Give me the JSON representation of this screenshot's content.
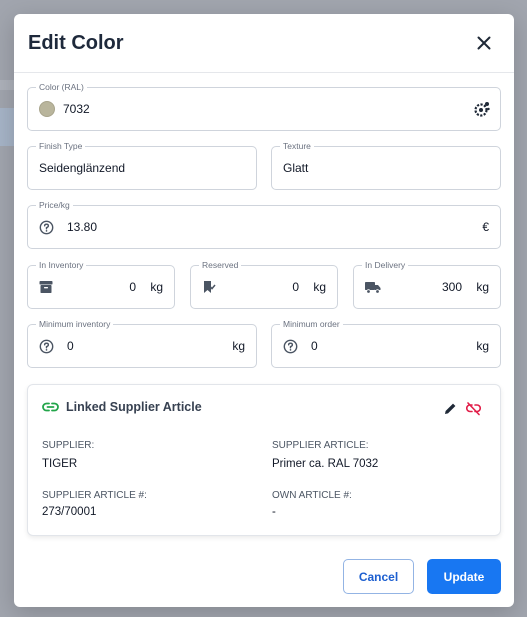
{
  "modal": {
    "title": "Edit Color"
  },
  "fields": {
    "color": {
      "label": "Color (RAL)",
      "value": "7032",
      "swatch_color": "#b9b59c"
    },
    "finish_type": {
      "label": "Finish Type",
      "value": "Seidenglänzend"
    },
    "texture": {
      "label": "Texture",
      "value": "Glatt"
    },
    "price": {
      "label": "Price/kg",
      "value": "13.80",
      "unit": "€"
    },
    "in_inventory": {
      "label": "In Inventory",
      "value": "0",
      "unit": "kg"
    },
    "reserved": {
      "label": "Reserved",
      "value": "0",
      "unit": "kg"
    },
    "in_delivery": {
      "label": "In Delivery",
      "value": "300",
      "unit": "kg"
    },
    "minimum_inventory": {
      "label": "Minimum inventory",
      "value": "0",
      "unit": "kg"
    },
    "minimum_order": {
      "label": "Minimum order",
      "value": "0",
      "unit": "kg"
    }
  },
  "linked_article": {
    "title": "Linked Supplier Article",
    "supplier_label": "SUPPLIER:",
    "supplier_value": "TIGER",
    "supplier_article_label": "SUPPLIER ARTICLE:",
    "supplier_article_value": "Primer ca. RAL 7032",
    "supplier_article_no_label": "SUPPLIER ARTICLE #:",
    "supplier_article_no_value": "273/70001",
    "own_article_no_label": "OWN ARTICLE #:",
    "own_article_no_value": "-"
  },
  "buttons": {
    "cancel": "Cancel",
    "update": "Update"
  },
  "colors": {
    "primary": "#1877f2",
    "link_icon": "#22a54a",
    "unlink_icon": "#e11d48"
  }
}
